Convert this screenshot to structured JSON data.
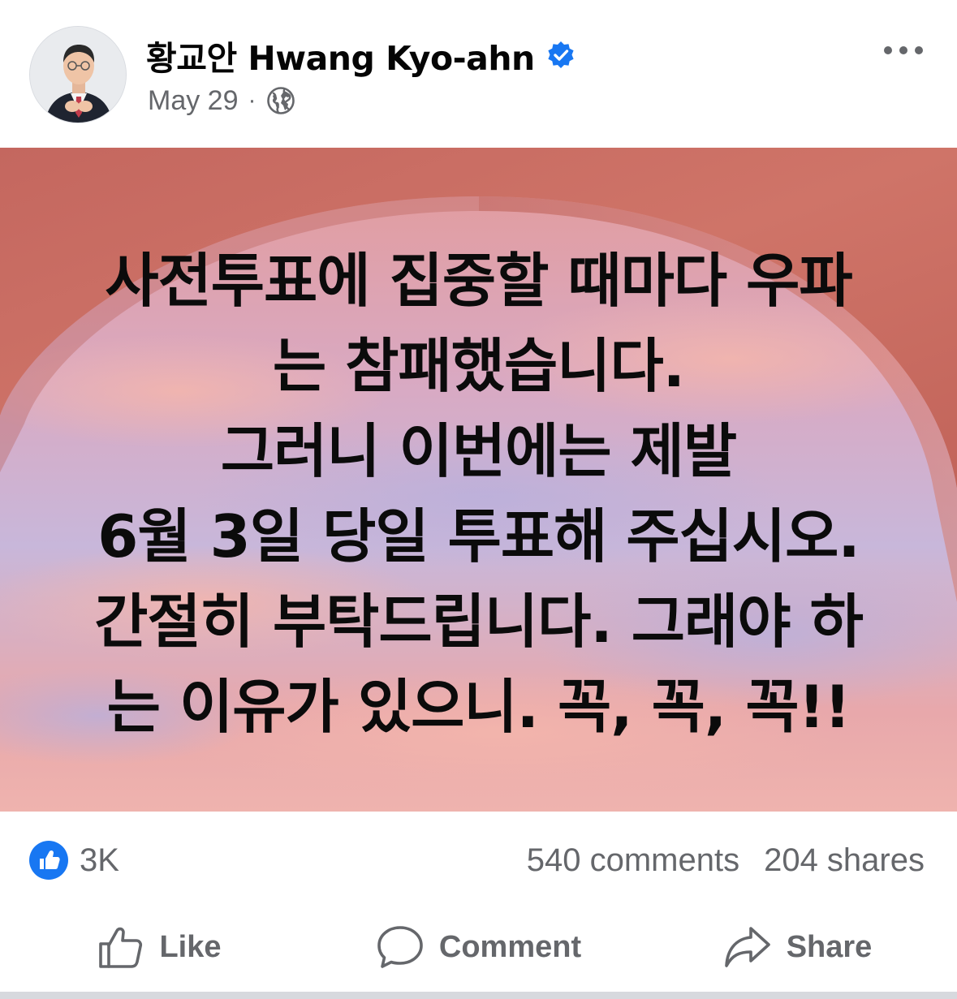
{
  "post": {
    "author": "황교안 Hwang Kyo-ahn",
    "date": "May 29",
    "separator": "·",
    "privacy_icon": "globe-icon",
    "verified_icon": "verified-badge-icon",
    "more_icon": "more-options-icon"
  },
  "image": {
    "lines": [
      "사전투표에 집중할 때마다 우파",
      "는 참패했습니다.",
      "그러니 이번에는 제발",
      "6월 3일 당일 투표해 주십시오.",
      "간절히 부탁드립니다. 그래야 하",
      "는 이유가 있으니. 꼭, 꼭, 꼭!!"
    ]
  },
  "stats": {
    "reactions": "3K",
    "comments": "540 comments",
    "shares": "204 shares"
  },
  "actions": {
    "like": "Like",
    "comment": "Comment",
    "share": "Share"
  },
  "colors": {
    "accent_blue": "#1877f2",
    "secondary_text": "#65676b",
    "primary_text": "#050505",
    "arch_color": "#c9665a",
    "sky_pink": "#eaa8a9",
    "sky_lavender": "#c6b6d8"
  }
}
